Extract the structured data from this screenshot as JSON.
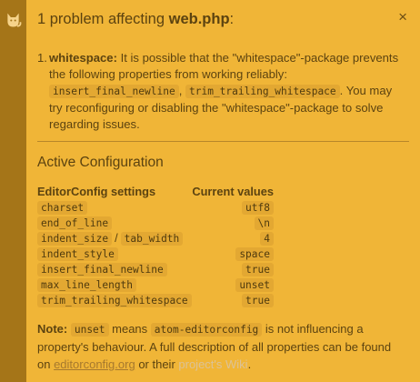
{
  "header": {
    "prefix": "1 problem affecting ",
    "file": "web.php",
    "suffix": ":",
    "close_glyph": "×"
  },
  "problem": {
    "number": "1.",
    "property": "whitespace:",
    "text1": " It is possible that the \"whitespace\"-package prevents the following properties from working reliably: ",
    "code1": "insert_final_newline",
    "comma": ", ",
    "code2": "trim_trailing_whitespace",
    "text2": ". You may try reconfiguring or disabling the \"whitespace\"-package to solve regarding issues."
  },
  "config": {
    "title": "Active Configuration",
    "col_settings": "EditorConfig settings",
    "col_values": "Current values",
    "rows": [
      {
        "key": "charset",
        "value": "utf8"
      },
      {
        "key": "end_of_line",
        "value": "\\n"
      },
      {
        "key": "indent_size",
        "key2": "tab_width",
        "sep": "/",
        "value": "4"
      },
      {
        "key": "indent_style",
        "value": "space"
      },
      {
        "key": "insert_final_newline",
        "value": "true"
      },
      {
        "key": "max_line_length",
        "value": "unset"
      },
      {
        "key": "trim_trailing_whitespace",
        "value": "true"
      }
    ]
  },
  "note": {
    "label": "Note:",
    "code1": "unset",
    "t1": " means ",
    "code2": "atom-editorconfig",
    "t2": " is not influencing a property's behaviour. A full description of all properties can be found on ",
    "link1": "editorconfig.org",
    "t3": " or their ",
    "link2": "project's Wiki",
    "t4": "."
  },
  "colors": {
    "background": "#f0b537",
    "strip": "#a57518",
    "text": "#5c4310"
  }
}
